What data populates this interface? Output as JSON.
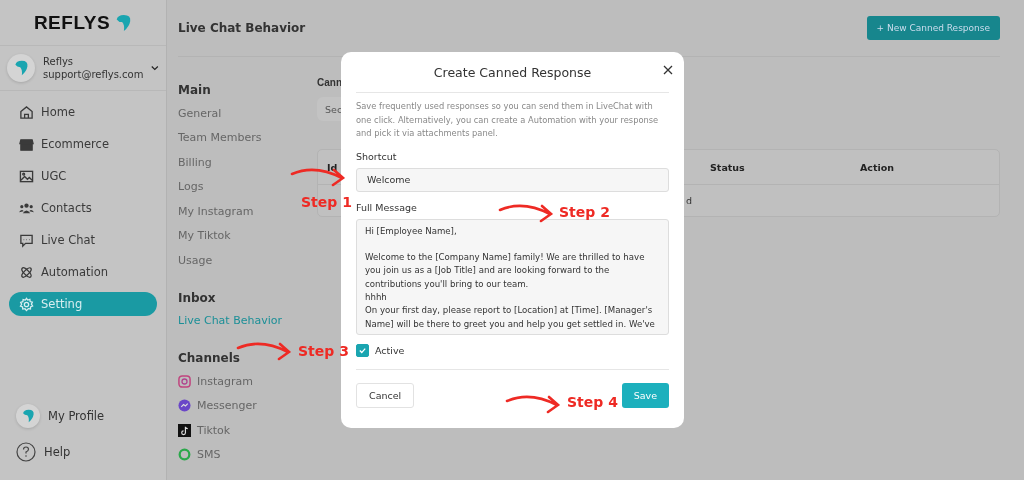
{
  "sidebar": {
    "logo": "REFLYS",
    "account": {
      "name": "Reflys",
      "email": "support@reflys.com"
    },
    "nav": [
      {
        "label": "Home",
        "selected": false
      },
      {
        "label": "Ecommerce",
        "selected": false
      },
      {
        "label": "UGC",
        "selected": false
      },
      {
        "label": "Contacts",
        "selected": false
      },
      {
        "label": "Live Chat",
        "selected": false
      },
      {
        "label": "Automation",
        "selected": false
      },
      {
        "label": "Setting",
        "selected": true
      }
    ],
    "footer": [
      {
        "label": "My Profile",
        "kind": "avatar"
      },
      {
        "label": "Help",
        "kind": "help"
      }
    ]
  },
  "header": {
    "title": "Live Chat Behavior",
    "new_button": "+ New Canned Response"
  },
  "settings_menu": [
    {
      "heading": "Main",
      "items": [
        {
          "label": "General",
          "selected": false
        },
        {
          "label": "Team Members",
          "selected": false
        },
        {
          "label": "Billing",
          "selected": false
        },
        {
          "label": "Logs",
          "selected": false
        },
        {
          "label": "My Instagram",
          "selected": false
        },
        {
          "label": "My Tiktok",
          "selected": false
        },
        {
          "label": "Usage",
          "selected": false
        }
      ]
    },
    {
      "heading": "Inbox",
      "items": [
        {
          "label": "Live Chat Behavior",
          "selected": true
        }
      ]
    },
    {
      "heading": "Channels",
      "items": [
        {
          "label": "Instagram",
          "selected": false
        },
        {
          "label": "Messenger",
          "selected": false
        },
        {
          "label": "Tiktok",
          "selected": false
        },
        {
          "label": "SMS",
          "selected": false
        }
      ]
    }
  ],
  "content": {
    "section_label": "Cann",
    "search_placeholder": "Sec",
    "table": {
      "columns": [
        "Id",
        "Status",
        "Action"
      ],
      "row_text": "d"
    }
  },
  "modal": {
    "title": "Create Canned Response",
    "description": "Save frequently used responses so you can send them in LiveChat with one click. Alternatively, you can create a Automation with your response and pick it via attachments panel.",
    "shortcut": {
      "label": "Shortcut",
      "value": "Welcome"
    },
    "message": {
      "label": "Full Message",
      "value": "Hi [Employee Name],\n\nWelcome to the [Company Name] family! We are thrilled to have you join us as a [Job Title] and are looking forward to the contributions you'll bring to our team.\nhhhh\nOn your first day, please report to [Location] at [Time]. [Manager's Name] will be there to greet you and help you get settled in. We've"
    },
    "active": {
      "label": "Active",
      "checked": true
    },
    "cancel": "Cancel",
    "save": "Save"
  },
  "annotations": [
    {
      "label": "Step 1"
    },
    {
      "label": "Step 2"
    },
    {
      "label": "Step 3"
    },
    {
      "label": "Step 4"
    }
  ]
}
